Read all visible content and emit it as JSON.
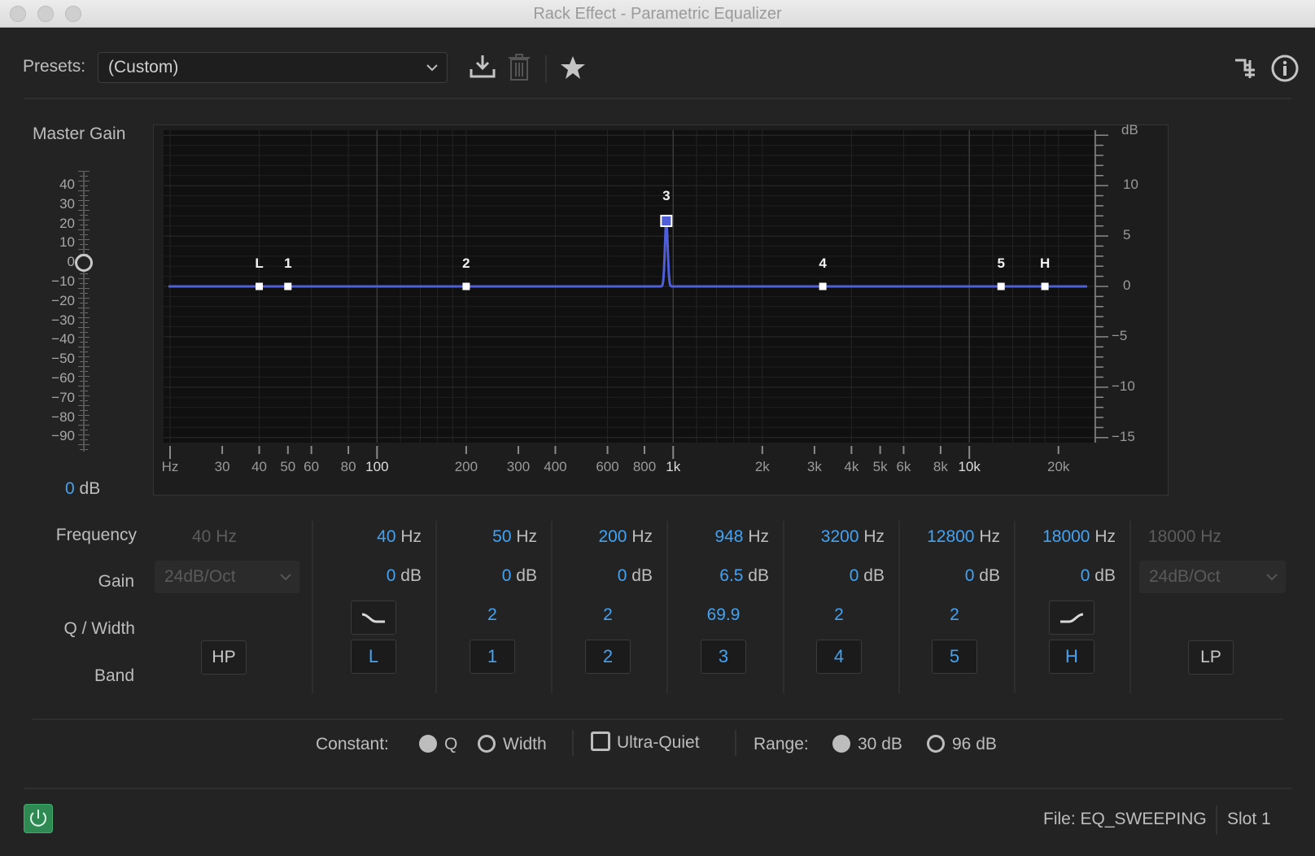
{
  "window": {
    "title": "Rack Effect - Parametric Equalizer"
  },
  "presets": {
    "label": "Presets:",
    "value": "(Custom)"
  },
  "toolbar_icons": [
    "save-preset-icon",
    "delete-preset-icon",
    "favorite-star-icon",
    "routing-icon",
    "info-icon"
  ],
  "master_gain": {
    "label": "Master Gain",
    "scale": [
      "40",
      "30",
      "20",
      "10",
      "0",
      "−10",
      "−20",
      "−30",
      "−40",
      "−50",
      "−60",
      "−70",
      "−80",
      "−90"
    ],
    "value": "0",
    "unit": "dB"
  },
  "graph": {
    "freq_ticks": [
      {
        "label": "Hz",
        "hz": 20
      },
      {
        "label": "30",
        "hz": 30
      },
      {
        "label": "40",
        "hz": 40
      },
      {
        "label": "50",
        "hz": 50
      },
      {
        "label": "60",
        "hz": 60
      },
      {
        "label": "80",
        "hz": 80
      },
      {
        "label": "100",
        "hz": 100,
        "bold": true
      },
      {
        "label": "200",
        "hz": 200
      },
      {
        "label": "300",
        "hz": 300
      },
      {
        "label": "400",
        "hz": 400
      },
      {
        "label": "600",
        "hz": 600
      },
      {
        "label": "800",
        "hz": 800
      },
      {
        "label": "1k",
        "hz": 1000,
        "bold": true
      },
      {
        "label": "2k",
        "hz": 2000
      },
      {
        "label": "3k",
        "hz": 3000
      },
      {
        "label": "4k",
        "hz": 4000
      },
      {
        "label": "5k",
        "hz": 5000
      },
      {
        "label": "6k",
        "hz": 6000
      },
      {
        "label": "8k",
        "hz": 8000
      },
      {
        "label": "10k",
        "hz": 10000,
        "bold": true
      },
      {
        "label": "20k",
        "hz": 20000
      }
    ],
    "db_unit": "dB",
    "db_ticks": [
      {
        "label": "10",
        "db": 10
      },
      {
        "label": "5",
        "db": 5
      },
      {
        "label": "0",
        "db": 0
      },
      {
        "label": "−5",
        "db": -5
      },
      {
        "label": "−10",
        "db": -10
      },
      {
        "label": "−15",
        "db": -15
      }
    ],
    "db_range": [
      -15.5,
      15.5
    ],
    "line_color": "#4f5fd8",
    "bands": [
      {
        "label": "L",
        "hz": 40,
        "db": 0
      },
      {
        "label": "1",
        "hz": 50,
        "db": 0
      },
      {
        "label": "2",
        "hz": 200,
        "db": 0
      },
      {
        "label": "3",
        "hz": 948,
        "db": 6.5,
        "selected": true
      },
      {
        "label": "4",
        "hz": 3200,
        "db": 0
      },
      {
        "label": "5",
        "hz": 12800,
        "db": 0
      },
      {
        "label": "H",
        "hz": 18000,
        "db": 0
      }
    ]
  },
  "params": {
    "row_labels": {
      "frequency": "Frequency",
      "gain": "Gain",
      "q": "Q / Width",
      "band": "Band"
    },
    "hp": {
      "freq": "40",
      "unit": "Hz",
      "slope": "24dB/Oct",
      "button": "HP"
    },
    "lp": {
      "freq": "18000",
      "unit": "Hz",
      "slope": "24dB/Oct",
      "button": "LP"
    },
    "bands": [
      {
        "freq": "40",
        "freq_unit": "Hz",
        "gain": "0",
        "gain_unit": "dB",
        "q": "",
        "shelf": "low-shelf-icon",
        "button": "L"
      },
      {
        "freq": "50",
        "freq_unit": "Hz",
        "gain": "0",
        "gain_unit": "dB",
        "q": "2",
        "button": "1"
      },
      {
        "freq": "200",
        "freq_unit": "Hz",
        "gain": "0",
        "gain_unit": "dB",
        "q": "2",
        "button": "2"
      },
      {
        "freq": "948",
        "freq_unit": "Hz",
        "gain": "6.5",
        "gain_unit": "dB",
        "q": "69.9",
        "button": "3"
      },
      {
        "freq": "3200",
        "freq_unit": "Hz",
        "gain": "0",
        "gain_unit": "dB",
        "q": "2",
        "button": "4"
      },
      {
        "freq": "12800",
        "freq_unit": "Hz",
        "gain": "0",
        "gain_unit": "dB",
        "q": "2",
        "button": "5"
      },
      {
        "freq": "18000",
        "freq_unit": "Hz",
        "gain": "0",
        "gain_unit": "dB",
        "q": "",
        "shelf": "high-shelf-icon",
        "button": "H"
      }
    ]
  },
  "options": {
    "constant_label": "Constant:",
    "q_label": "Q",
    "width_label": "Width",
    "ultra_quiet_label": "Ultra-Quiet",
    "range_label": "Range:",
    "range_30": "30 dB",
    "range_96": "96 dB",
    "constant_selected": "Q",
    "range_selected": "30 dB",
    "ultra_quiet_checked": false
  },
  "footer": {
    "file_label": "File: EQ_SWEEPING",
    "slot_label": "Slot 1"
  },
  "colors": {
    "accent": "#43a3f2",
    "power": "#2e8a52"
  }
}
